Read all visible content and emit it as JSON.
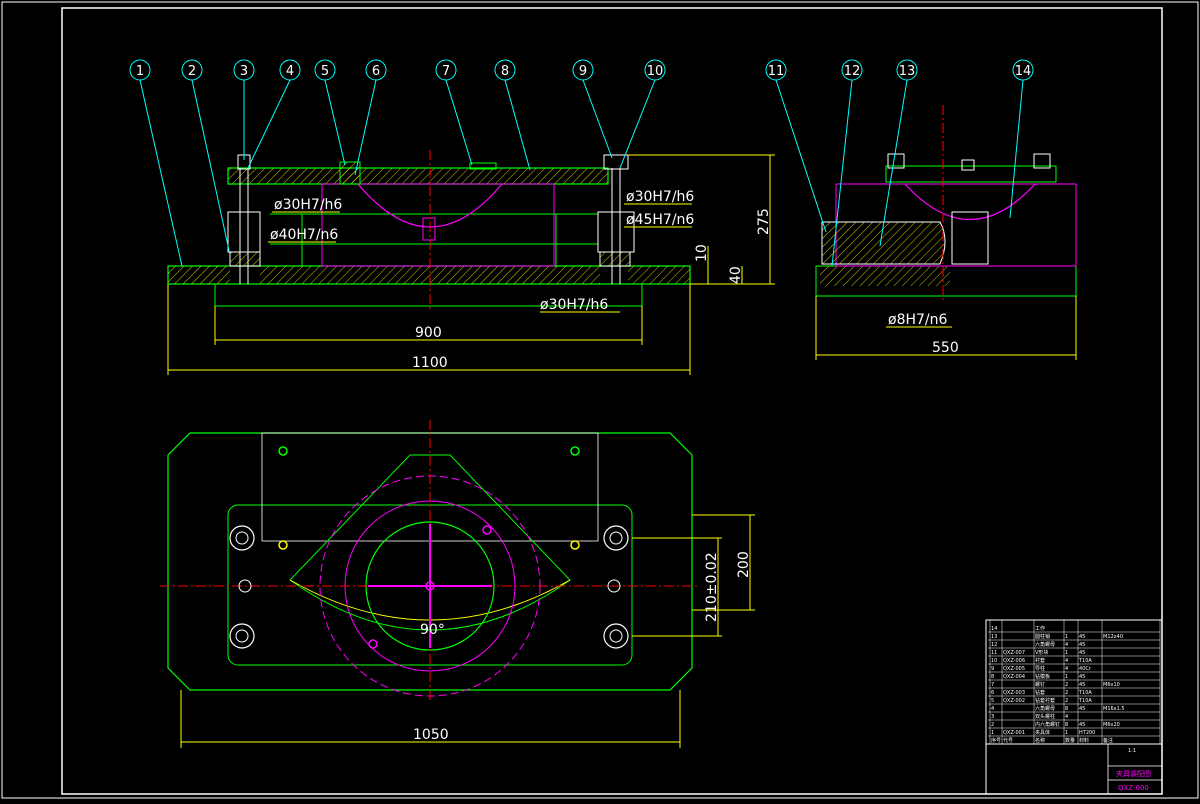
{
  "colors": {
    "background": "#000000",
    "frame": "#ffffff",
    "part": "#00ff00",
    "hidden": "#ff00ff",
    "center": "#ff0000",
    "dimension": "#ffff00",
    "leader": "#00ffff",
    "text": "#ffffff",
    "hatch": "#ffff00"
  },
  "callouts": [
    "1",
    "2",
    "3",
    "4",
    "5",
    "6",
    "7",
    "8",
    "9",
    "10",
    "11",
    "12",
    "13",
    "14"
  ],
  "dimensions": {
    "front_fit_1": "ø30H7/h6",
    "front_fit_2": "ø40H7/n6",
    "front_fit_3": "ø30H7/h6",
    "front_fit_4": "ø45H7/n6",
    "front_fit_5": "ø30H7/h6",
    "height_total": "275",
    "height_10": "10",
    "height_40": "40",
    "width_900": "900",
    "width_1100": "1100",
    "side_fit": "ø8H7/n6",
    "side_width": "550",
    "plan_angle": "90°",
    "plan_210": "210±0.02",
    "plan_200": "200",
    "plan_width": "1050"
  },
  "title_block": {
    "rows": [
      {
        "no": "14",
        "code": "",
        "name": "工作",
        "qty": "",
        "material": "",
        "note": ""
      },
      {
        "no": "13",
        "code": "",
        "name": "圆柱销",
        "qty": "1",
        "material": "45",
        "note": "M12x40"
      },
      {
        "no": "12",
        "code": "",
        "name": "六角螺母",
        "qty": "4",
        "material": "45",
        "note": ""
      },
      {
        "no": "11",
        "code": "QXZ-007",
        "name": "V形块",
        "qty": "1",
        "material": "45",
        "note": ""
      },
      {
        "no": "10",
        "code": "QXZ-006",
        "name": "衬套",
        "qty": "4",
        "material": "T10A",
        "note": ""
      },
      {
        "no": "9",
        "code": "QXZ-005",
        "name": "导柱",
        "qty": "4",
        "material": "40Cr",
        "note": ""
      },
      {
        "no": "8",
        "code": "QXZ-004",
        "name": "钻模板",
        "qty": "1",
        "material": "45",
        "note": ""
      },
      {
        "no": "7",
        "code": "",
        "name": "螺钉",
        "qty": "2",
        "material": "45",
        "note": "M6x10"
      },
      {
        "no": "6",
        "code": "QXZ-003",
        "name": "钻套",
        "qty": "2",
        "material": "T10A",
        "note": ""
      },
      {
        "no": "5",
        "code": "QXZ-002",
        "name": "钻套衬套",
        "qty": "2",
        "material": "T10A",
        "note": ""
      },
      {
        "no": "4",
        "code": "",
        "name": "六角螺母",
        "qty": "8",
        "material": "45",
        "note": "M16x1.5"
      },
      {
        "no": "3",
        "code": "",
        "name": "双头螺柱",
        "qty": "4",
        "material": "",
        "note": ""
      },
      {
        "no": "2",
        "code": "",
        "name": "内六角螺钉",
        "qty": "8",
        "material": "45",
        "note": "M6x20"
      },
      {
        "no": "1",
        "code": "QXZ-001",
        "name": "夹具体",
        "qty": "1",
        "material": "HT200",
        "note": ""
      }
    ],
    "header": {
      "no": "序号",
      "code": "代号",
      "name": "名称",
      "qty": "数量",
      "material": "材料",
      "note": "备注"
    },
    "scale": "1:1",
    "drawing_title": "夹具装配图",
    "drawing_number": "QXZ-000"
  }
}
